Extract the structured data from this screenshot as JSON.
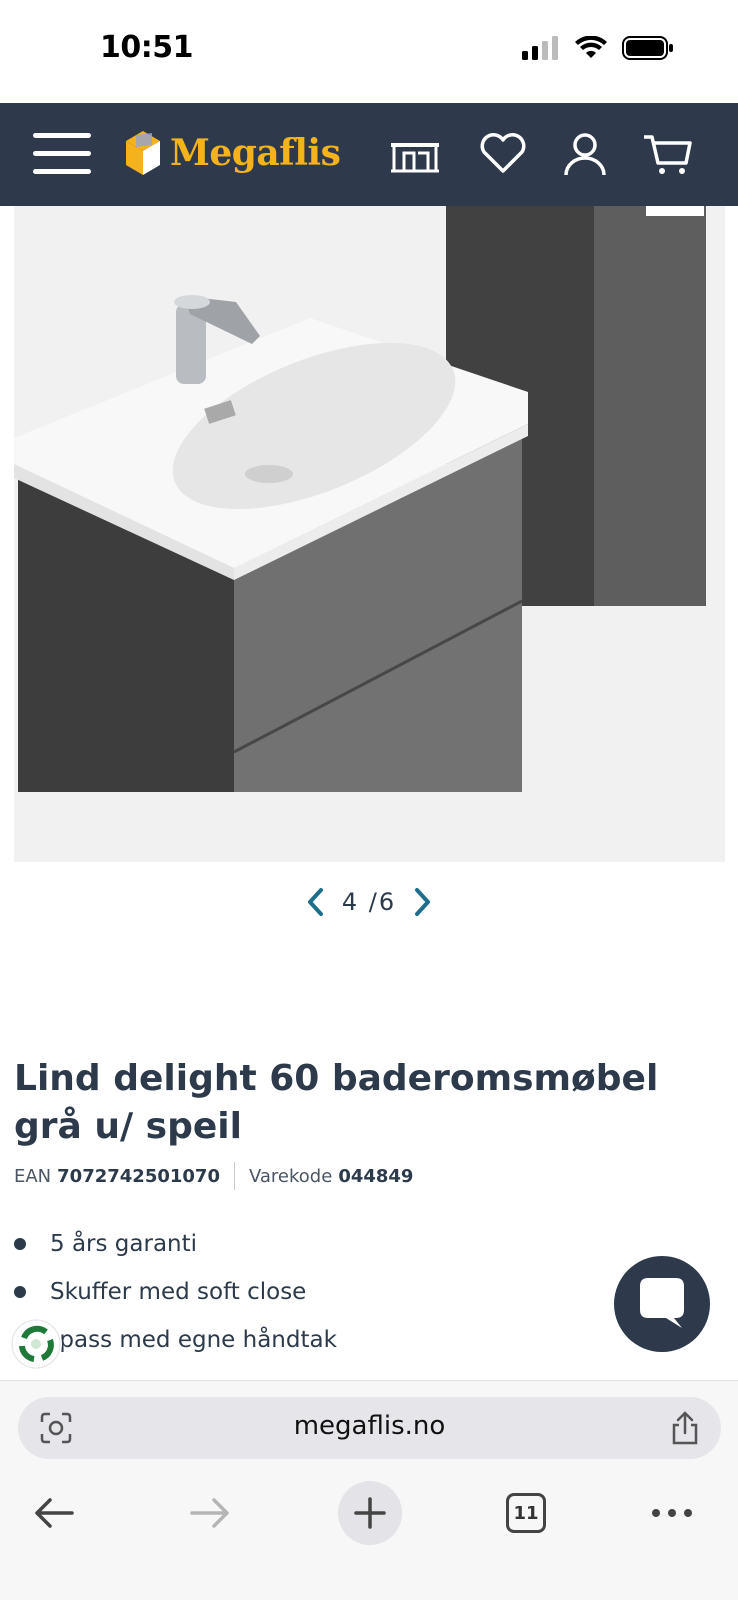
{
  "status_bar": {
    "time": "10:51"
  },
  "header": {
    "brand": "Megaflis",
    "menu_icon": "hamburger-menu-icon",
    "store_icon": "store-icon",
    "favorites_icon": "heart-icon",
    "account_icon": "user-icon",
    "cart_icon": "cart-icon",
    "brand_color": "#f5b21b",
    "background": "#2e3a4b"
  },
  "gallery": {
    "current": "4",
    "total": "6",
    "counter_sep": "/",
    "prev_icon": "chevron-left-icon",
    "next_icon": "chevron-right-icon",
    "accent": "#1f6e8c"
  },
  "product": {
    "title": "Lind delight 60 baderomsmøbel grå u/ speil",
    "ean_label": "EAN",
    "ean": "7072742501070",
    "sku_label": "Varekode",
    "sku": "044849",
    "features": [
      "5 års garanti",
      "Skuffer med soft close",
      "lpass med egne håndtak"
    ]
  },
  "chat": {
    "icon": "chat-bubble-icon"
  },
  "browser": {
    "url": "megaflis.no",
    "tabs_count": "11",
    "back_icon": "arrow-left-icon",
    "forward_icon": "arrow-right-icon",
    "new_tab_icon": "plus-icon",
    "more_icon": "more-dots-icon"
  }
}
